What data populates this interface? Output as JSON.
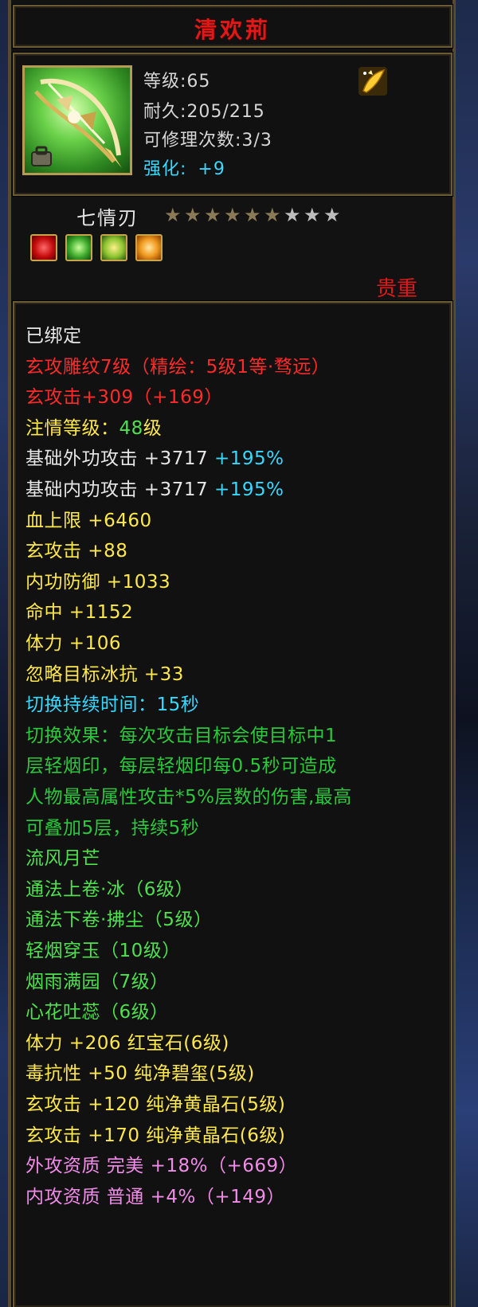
{
  "item": {
    "title": "清欢荊",
    "level_text": "等级:65",
    "durability_text": "耐久:205/215",
    "repair_text": "可修理次数:3/3",
    "enhance_label": "强化:",
    "enhance_value": "+9",
    "weapon_name": "七情刃",
    "stars_total": 9,
    "stars_filled": 6,
    "rarity": "贵重"
  },
  "icons": {
    "item_icon": "bow-weapon-icon",
    "bag_icon": "bag-icon",
    "gold_icon": "gold-feather-icon",
    "gems": [
      "red-gem-icon",
      "green-gem-icon",
      "green-yellow-gem-icon",
      "gold-flower-gem-icon"
    ]
  },
  "colors": {
    "white": "#e6e6e6",
    "red": "#ff2a2a",
    "yellow": "#ffe84a",
    "green": "#4ee04e",
    "cyan": "#38d8ff",
    "teal_green": "#2cc83c",
    "pink": "#f08ce8",
    "star_filled": "#8a7a55",
    "star_empty": "#bdbdbd"
  },
  "attributes": [
    {
      "segs": [
        {
          "t": "已绑定",
          "c": "white"
        }
      ]
    },
    {
      "segs": [
        {
          "t": "玄攻雕纹7级（精绘：5级1等·骛远）",
          "c": "red"
        }
      ]
    },
    {
      "segs": [
        {
          "t": "玄攻击+309（+169）",
          "c": "red"
        }
      ]
    },
    {
      "segs": [
        {
          "t": "注情等级：",
          "c": "yellow"
        },
        {
          "t": "48",
          "c": "green"
        },
        {
          "t": "级",
          "c": "yellow"
        }
      ]
    },
    {
      "segs": [
        {
          "t": "基础外功攻击 +3717 ",
          "c": "white"
        },
        {
          "t": "+195%",
          "c": "cyan"
        }
      ]
    },
    {
      "segs": [
        {
          "t": "基础内功攻击 +3717 ",
          "c": "white"
        },
        {
          "t": "+195%",
          "c": "cyan"
        }
      ]
    },
    {
      "segs": [
        {
          "t": "血上限 +6460",
          "c": "yellow"
        }
      ]
    },
    {
      "segs": [
        {
          "t": "玄攻击 +88",
          "c": "yellow"
        }
      ]
    },
    {
      "segs": [
        {
          "t": "内功防御 +1033",
          "c": "yellow"
        }
      ]
    },
    {
      "segs": [
        {
          "t": "命中 +1152",
          "c": "yellow"
        }
      ]
    },
    {
      "segs": [
        {
          "t": "体力 +106",
          "c": "yellow"
        }
      ]
    },
    {
      "segs": [
        {
          "t": "忽略目标冰抗 +33",
          "c": "yellow"
        }
      ]
    },
    {
      "segs": [
        {
          "t": "切换持续时间：15秒",
          "c": "cyan"
        }
      ]
    },
    {
      "segs": [
        {
          "t": "切换效果：每次攻击目标会使目标中1",
          "c": "teal_green"
        }
      ]
    },
    {
      "segs": [
        {
          "t": "层轻烟印，每层轻烟印每0.5秒可造成",
          "c": "teal_green"
        }
      ]
    },
    {
      "segs": [
        {
          "t": "人物最高属性攻击*5%层数的伤害,最高",
          "c": "teal_green"
        }
      ]
    },
    {
      "segs": [
        {
          "t": "可叠加5层，持续5秒",
          "c": "teal_green"
        }
      ]
    },
    {
      "segs": [
        {
          "t": "流风月芒",
          "c": "green"
        }
      ]
    },
    {
      "segs": [
        {
          "t": "通法上卷·冰（6级）",
          "c": "green"
        }
      ]
    },
    {
      "segs": [
        {
          "t": "通法下卷·拂尘（5级）",
          "c": "green"
        }
      ]
    },
    {
      "segs": [
        {
          "t": "轻烟穿玉（10级）",
          "c": "green"
        }
      ]
    },
    {
      "segs": [
        {
          "t": "烟雨满园（7级）",
          "c": "green"
        }
      ]
    },
    {
      "segs": [
        {
          "t": "心花吐蕊（6级）",
          "c": "green"
        }
      ]
    },
    {
      "segs": [
        {
          "t": "体力 +206 红宝石(6级)",
          "c": "yellow"
        }
      ]
    },
    {
      "segs": [
        {
          "t": "毒抗性 +50 纯净碧玺(5级)",
          "c": "yellow"
        }
      ]
    },
    {
      "segs": [
        {
          "t": "玄攻击 +120 纯净黄晶石(5级)",
          "c": "yellow"
        }
      ]
    },
    {
      "segs": [
        {
          "t": "玄攻击 +170 纯净黄晶石(6级)",
          "c": "yellow"
        }
      ]
    },
    {
      "segs": [
        {
          "t": "外攻资质  完美 +18%（+669）",
          "c": "pink"
        }
      ]
    },
    {
      "segs": [
        {
          "t": "内攻资质  普通 +4%（+149）",
          "c": "pink"
        }
      ]
    }
  ]
}
